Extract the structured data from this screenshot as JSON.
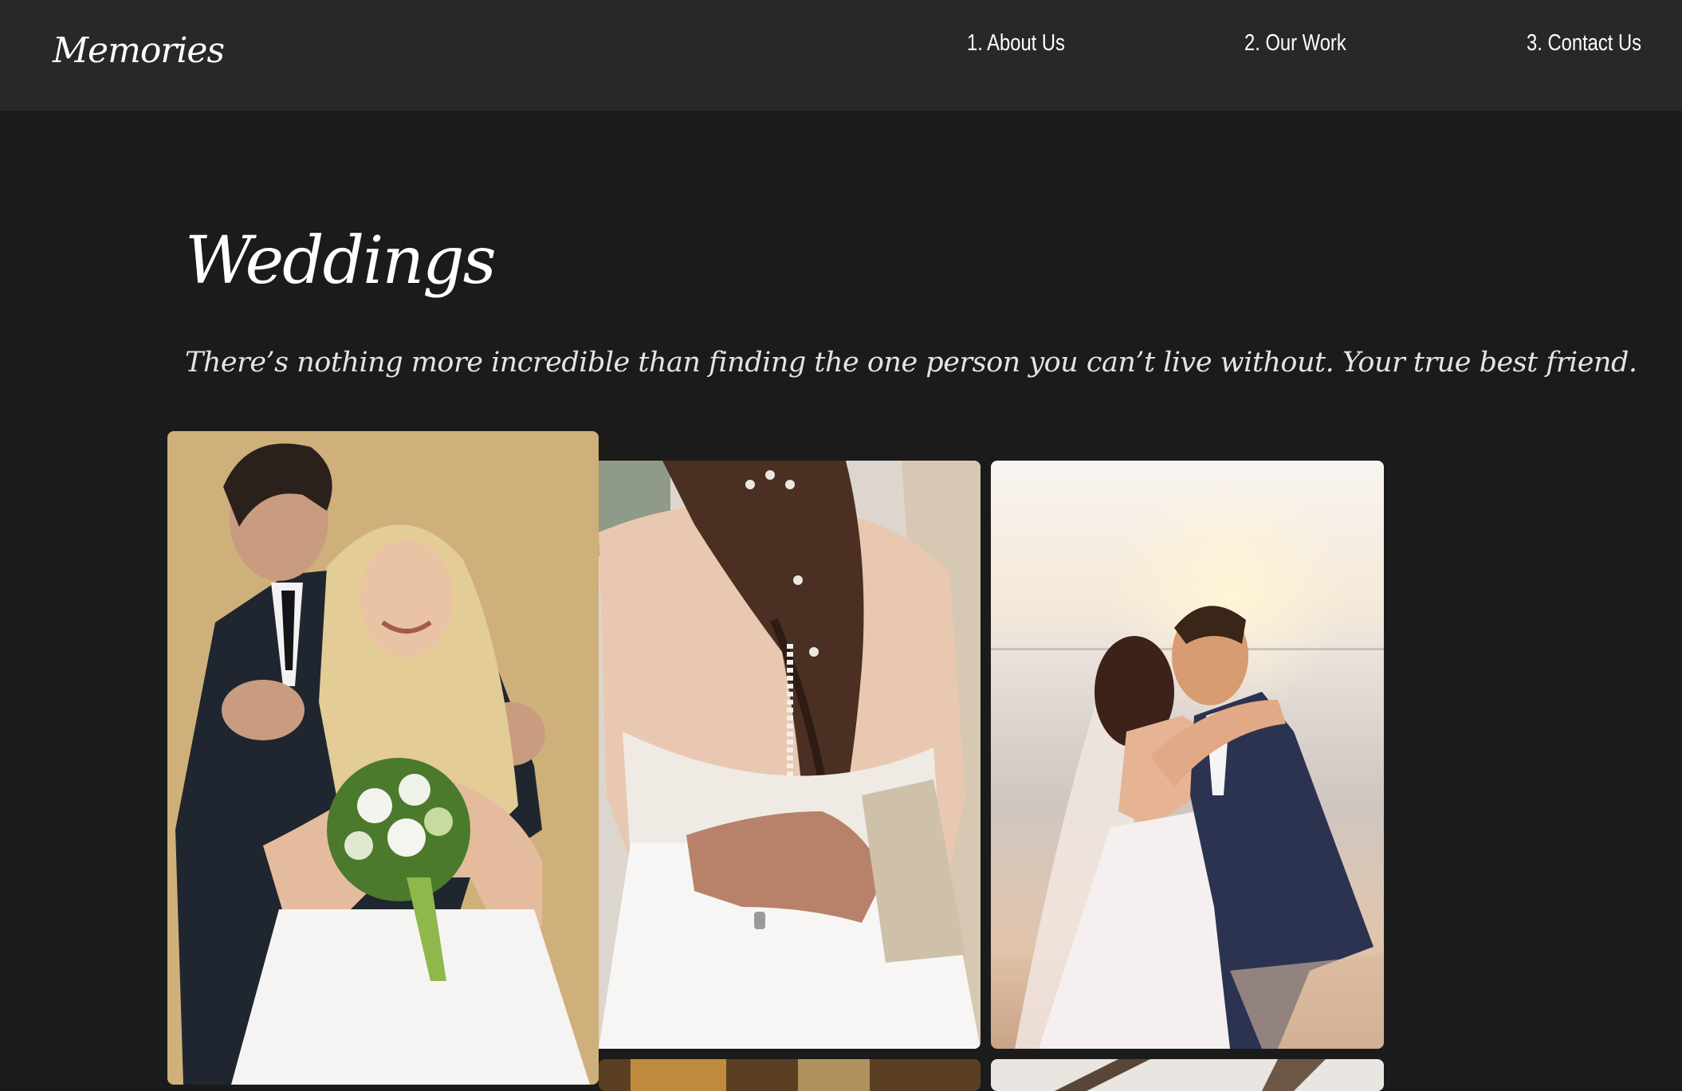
{
  "nav": {
    "logo": "Memories",
    "links": [
      {
        "label": "1. About Us"
      },
      {
        "label": "2. Our Work"
      },
      {
        "label": "3. Contact Us"
      }
    ]
  },
  "main": {
    "title": "Weddings",
    "tagline": "There’s nothing more incredible than finding the one person you can’t live without. Your true best friend."
  },
  "gallery": {
    "photos": [
      {
        "name": "couple with bouquet photo"
      },
      {
        "name": "bride back lace dress photo"
      },
      {
        "name": "beach sunset couple photo"
      }
    ]
  },
  "colors": {
    "page_bg": "#1b1b1b",
    "nav_bg": "#282828",
    "text": "#ffffff",
    "photo1_bg": "#cfb07a"
  }
}
